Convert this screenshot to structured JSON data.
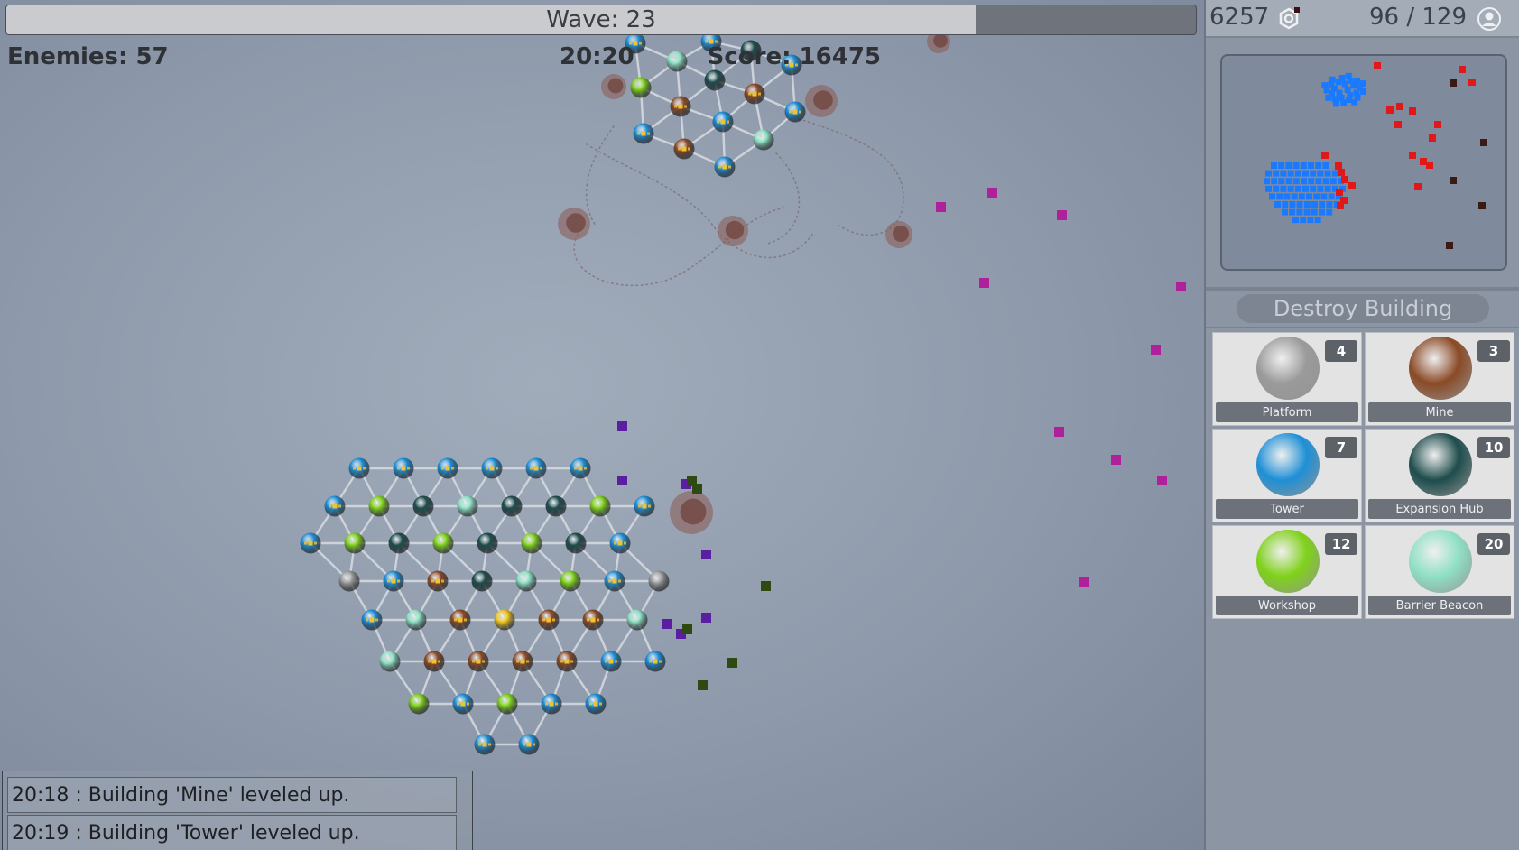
{
  "hud": {
    "wave_label": "Wave: 23",
    "wave_progress": 0.815,
    "enemies_label": "Enemies: 57",
    "timer_label": "20:20",
    "score_label": "Score: 16475"
  },
  "resources": {
    "gold": "6257",
    "gold_icon": "gear-coin-icon",
    "population": "96 / 129",
    "population_icon": "user-icon"
  },
  "destroy_button_label": "Destroy Building",
  "buildings": [
    {
      "name": "Platform",
      "cost": "4",
      "color": "#9a9a9a"
    },
    {
      "name": "Mine",
      "cost": "3",
      "color": "#8a4a26"
    },
    {
      "name": "Tower",
      "cost": "7",
      "color": "#1e8fd6"
    },
    {
      "name": "Expansion Hub",
      "cost": "10",
      "color": "#1e4c4c"
    },
    {
      "name": "Workshop",
      "cost": "12",
      "color": "#7fd11a"
    },
    {
      "name": "Barrier Beacon",
      "cost": "20",
      "color": "#8fe0c4"
    }
  ],
  "log": [
    "20:18 : Building 'Mine' leveled up.",
    "20:19 : Building 'Tower' leveled up."
  ],
  "colors": {
    "tower": "#1e8fd6",
    "mine": "#8a4a26",
    "hub": "#1e4c4c",
    "workshop": "#7fd11a",
    "beacon": "#8fe0c4",
    "platform": "#9a9a9a",
    "core": "#f0c419",
    "enemy_magenta": "#b0209a",
    "enemy_purple": "#5a1fa0",
    "enemy_green": "#2e4a12",
    "minimap_enemy": "#e01818",
    "minimap_unit": "#1a7aff"
  }
}
